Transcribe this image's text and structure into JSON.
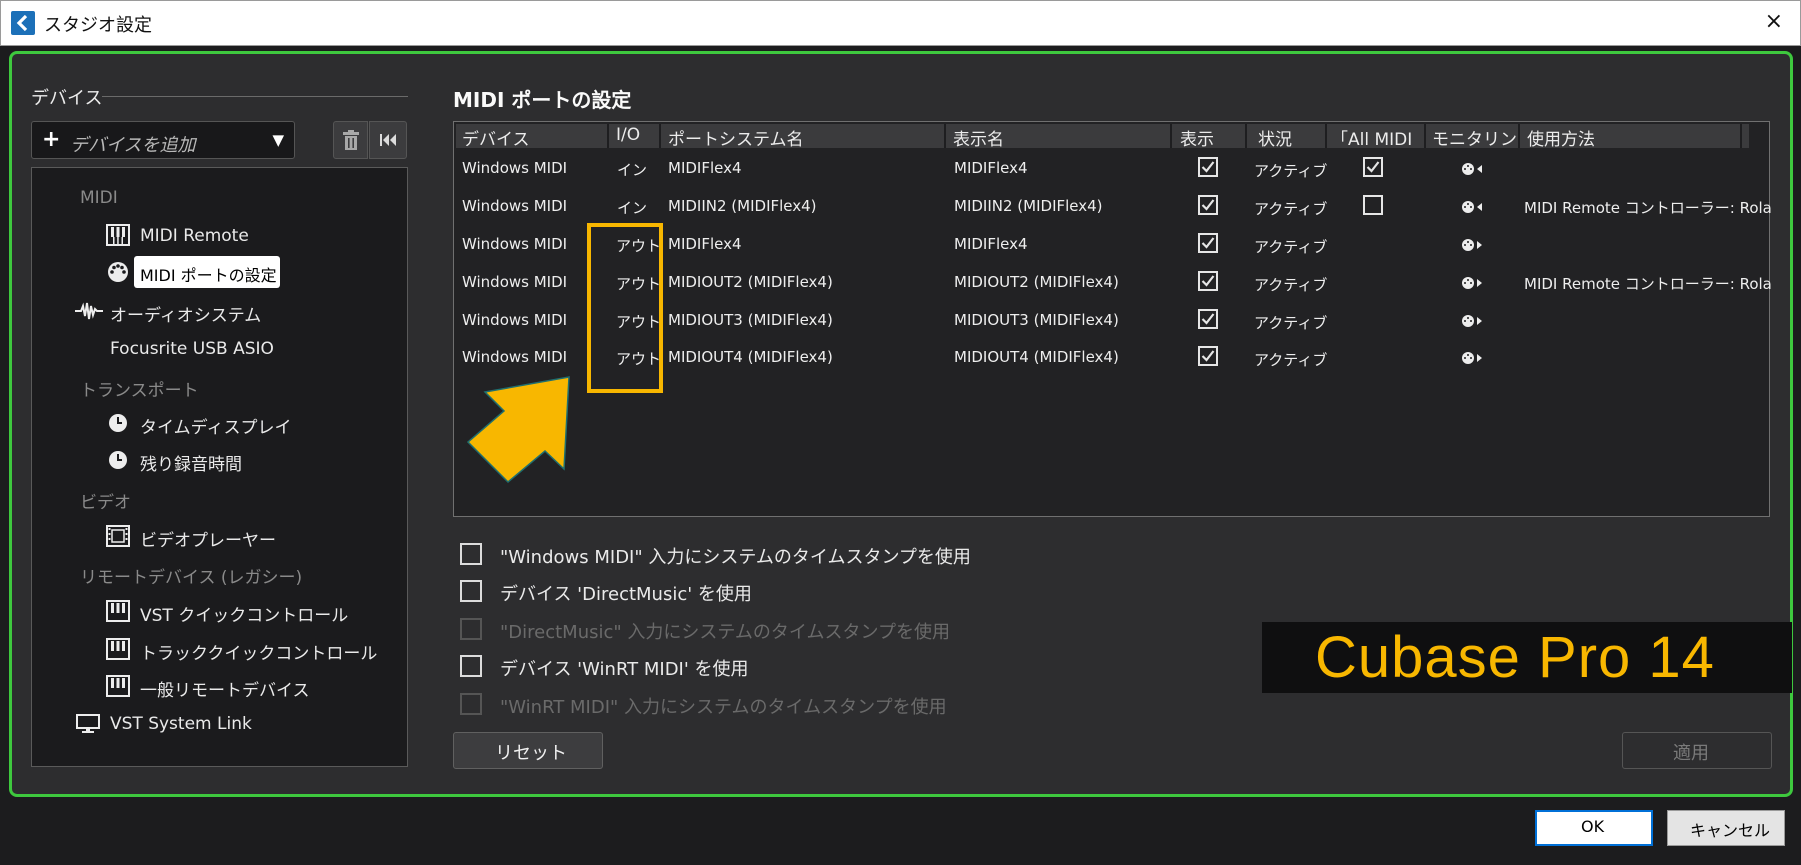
{
  "window": {
    "title": "スタジオ設定",
    "close_glyph": "×"
  },
  "sidebar": {
    "header": "デバイス",
    "add_device_label": "デバイスを追加",
    "add_plus": "+",
    "add_dropdown_glyph": "▼",
    "tree": {
      "cat_midi": "MIDI",
      "midi_remote": "MIDI Remote",
      "midi_port_settings": "MIDI ポートの設定",
      "audio_system": "オーディオシステム",
      "focusrite": "Focusrite USB ASIO",
      "cat_transport": "トランスポート",
      "time_display": "タイムディスプレイ",
      "remaining_rec_time": "残り録音時間",
      "cat_video": "ビデオ",
      "video_player": "ビデオプレーヤー",
      "cat_remote": "リモートデバイス (レガシー)",
      "vst_quick_controls": "VST クイックコントロール",
      "track_quick_controls": "トラッククイックコントロール",
      "generic_remote": "一般リモートデバイス",
      "vst_system_link": "VST System Link"
    }
  },
  "main": {
    "section_title": "MIDI ポートの設定",
    "columns": [
      "デバイス",
      "I/O",
      "ポートシステム名",
      "表示名",
      "表示",
      "状況",
      "「All MIDI",
      "モニタリン",
      "使用方法"
    ],
    "rows": [
      {
        "device": "Windows MIDI",
        "io": "イン",
        "port": "MIDIFlex4",
        "display": "MIDIFlex4",
        "visible": true,
        "status": "アクティブ",
        "all_midi": true,
        "usage": ""
      },
      {
        "device": "Windows MIDI",
        "io": "イン",
        "port": "MIDIIN2 (MIDIFlex4)",
        "display": "MIDIIN2 (MIDIFlex4)",
        "visible": true,
        "status": "アクティブ",
        "all_midi": false,
        "usage": "MIDI Remote コントローラー: Rola"
      },
      {
        "device": "Windows MIDI",
        "io": "アウト",
        "port": "MIDIFlex4",
        "display": "MIDIFlex4",
        "visible": true,
        "status": "アクティブ",
        "all_midi": null,
        "usage": ""
      },
      {
        "device": "Windows MIDI",
        "io": "アウト",
        "port": "MIDIOUT2 (MIDIFlex4)",
        "display": "MIDIOUT2 (MIDIFlex4)",
        "visible": true,
        "status": "アクティブ",
        "all_midi": null,
        "usage": "MIDI Remote コントローラー: Rola"
      },
      {
        "device": "Windows MIDI",
        "io": "アウト",
        "port": "MIDIOUT3 (MIDIFlex4)",
        "display": "MIDIOUT3 (MIDIFlex4)",
        "visible": true,
        "status": "アクティブ",
        "all_midi": null,
        "usage": ""
      },
      {
        "device": "Windows MIDI",
        "io": "アウト",
        "port": "MIDIOUT4 (MIDIFlex4)",
        "display": "MIDIOUT4 (MIDIFlex4)",
        "visible": true,
        "status": "アクティブ",
        "all_midi": null,
        "usage": ""
      }
    ],
    "options": [
      {
        "label": "\"Windows MIDI\" 入力にシステムのタイムスタンプを使用",
        "checked": false,
        "enabled": true
      },
      {
        "label": "デバイス 'DirectMusic' を使用",
        "checked": false,
        "enabled": true
      },
      {
        "label": "\"DirectMusic\" 入力にシステムのタイムスタンプを使用",
        "checked": false,
        "enabled": false
      },
      {
        "label": "デバイス 'WinRT MIDI' を使用",
        "checked": false,
        "enabled": true
      },
      {
        "label": "\"WinRT MIDI\" 入力にシステムのタイムスタンプを使用",
        "checked": false,
        "enabled": false
      }
    ],
    "reset_label": "リセット",
    "apply_label": "適用"
  },
  "overlay": {
    "product_label": "Cubase Pro 14",
    "accent_color": "#f8b700"
  },
  "footer": {
    "ok_label": "OK",
    "cancel_label": "キャンセル"
  },
  "colors": {
    "frame_border": "#3ec83e",
    "panel_bg": "#2d2d2f",
    "title_icon_bg": "#1c70b8"
  }
}
